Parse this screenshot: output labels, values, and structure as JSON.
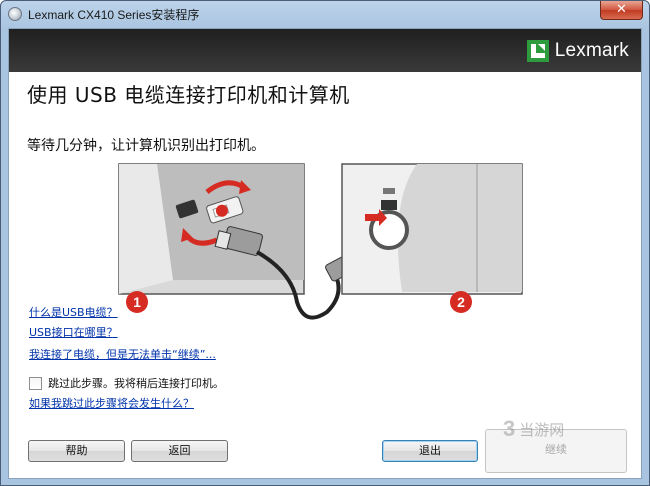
{
  "window": {
    "title": "Lexmark CX410 Series安装程序",
    "close_glyph": "✕"
  },
  "header": {
    "brand": "Lexmark",
    "brand_color": "#2e9b3f"
  },
  "page": {
    "title": "使用 USB 电缆连接打印机和计算机",
    "subtitle": "等待几分钟，让计算机识别出打印机。"
  },
  "illustration": {
    "step1_badge": "1",
    "step2_badge": "2",
    "badge_color": "#d62b22"
  },
  "links": {
    "what_is_usb": "什么是USB电缆？",
    "where_is_port": "USB接口在哪里？",
    "cannot_continue": "我连接了电缆，但是无法单击“继续”..."
  },
  "skip": {
    "checkbox_label": "跳过此步骤。我将稍后连接打印机。",
    "checked": false,
    "what_happens_link": "如果我跳过此步骤将会发生什么？"
  },
  "buttons": {
    "help": "帮助",
    "back": "返回",
    "exit": "退出",
    "continue": "继续"
  },
  "watermark": {
    "logo": "3",
    "text": "当游网"
  }
}
